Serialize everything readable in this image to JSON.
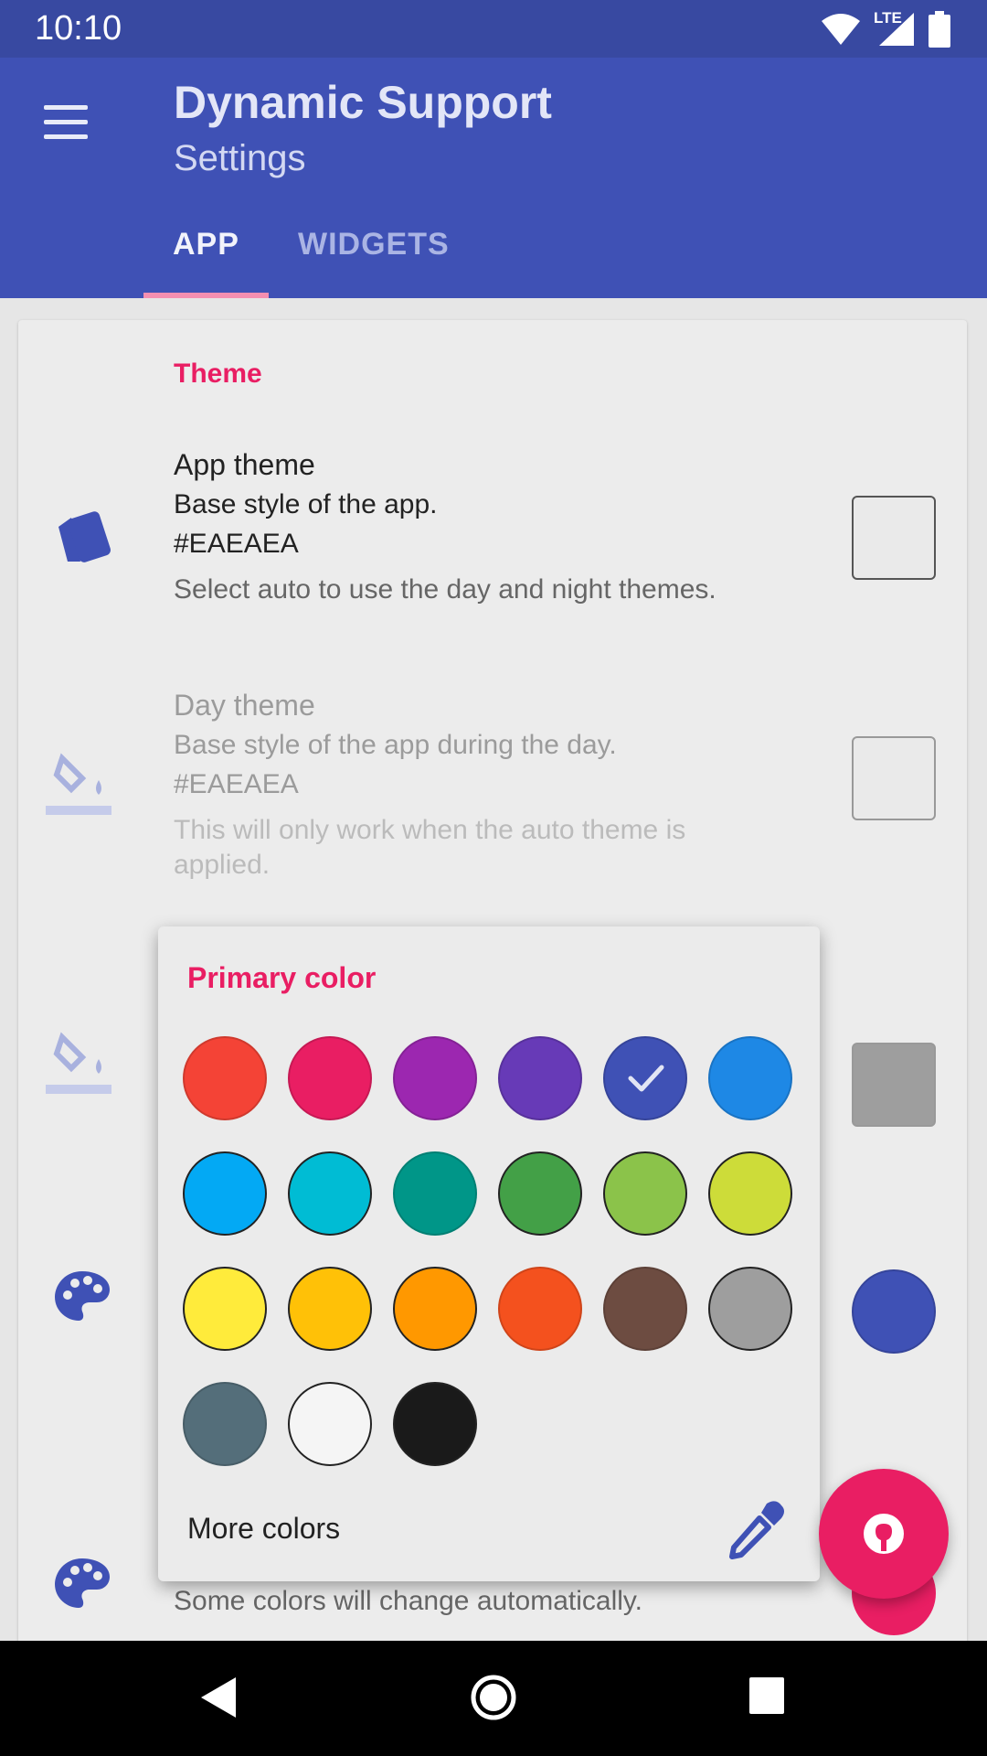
{
  "status_bar": {
    "time": "10:10",
    "network": "LTE"
  },
  "app_bar": {
    "title": "Dynamic Support",
    "subtitle": "Settings"
  },
  "tabs": [
    {
      "label": "APP",
      "selected": true
    },
    {
      "label": "WIDGETS",
      "selected": false
    }
  ],
  "section": {
    "header": "Theme"
  },
  "prefs": {
    "app_theme": {
      "title": "App theme",
      "summary": "Base style of the app.",
      "value": "#EAEAEA",
      "description": "Select auto to use the day and night themes.",
      "icon": "paint-swatch-icon"
    },
    "day_theme": {
      "title": "Day theme",
      "summary": "Base style of the app during the day.",
      "value": "#EAEAEA",
      "description": "This will only work when the auto theme is applied.",
      "icon": "paint-bucket-icon"
    },
    "obscured_value": "#FFE91E63",
    "obscured_description": "Some colors will change automatically."
  },
  "popup": {
    "title": "Primary color",
    "selected_color": "#3F51B5",
    "more_colors_label": "More colors",
    "colors": [
      "#F44336",
      "#E91E63",
      "#9C27B0",
      "#673AB7",
      "#3F51B5",
      "#1E88E5",
      "#03A9F4",
      "#00BCD4",
      "#009688",
      "#43A047",
      "#8BC34A",
      "#CDDC39",
      "#FFEB3B",
      "#FFC107",
      "#FF9800",
      "#F4511E",
      "#6D4C41",
      "#9E9E9E",
      "#546E7A",
      "#F5F5F5",
      "#1A1A1A"
    ]
  },
  "colors": {
    "primary": "#3F51B5",
    "accent": "#E91E63",
    "status_bar": "#3849A1"
  }
}
